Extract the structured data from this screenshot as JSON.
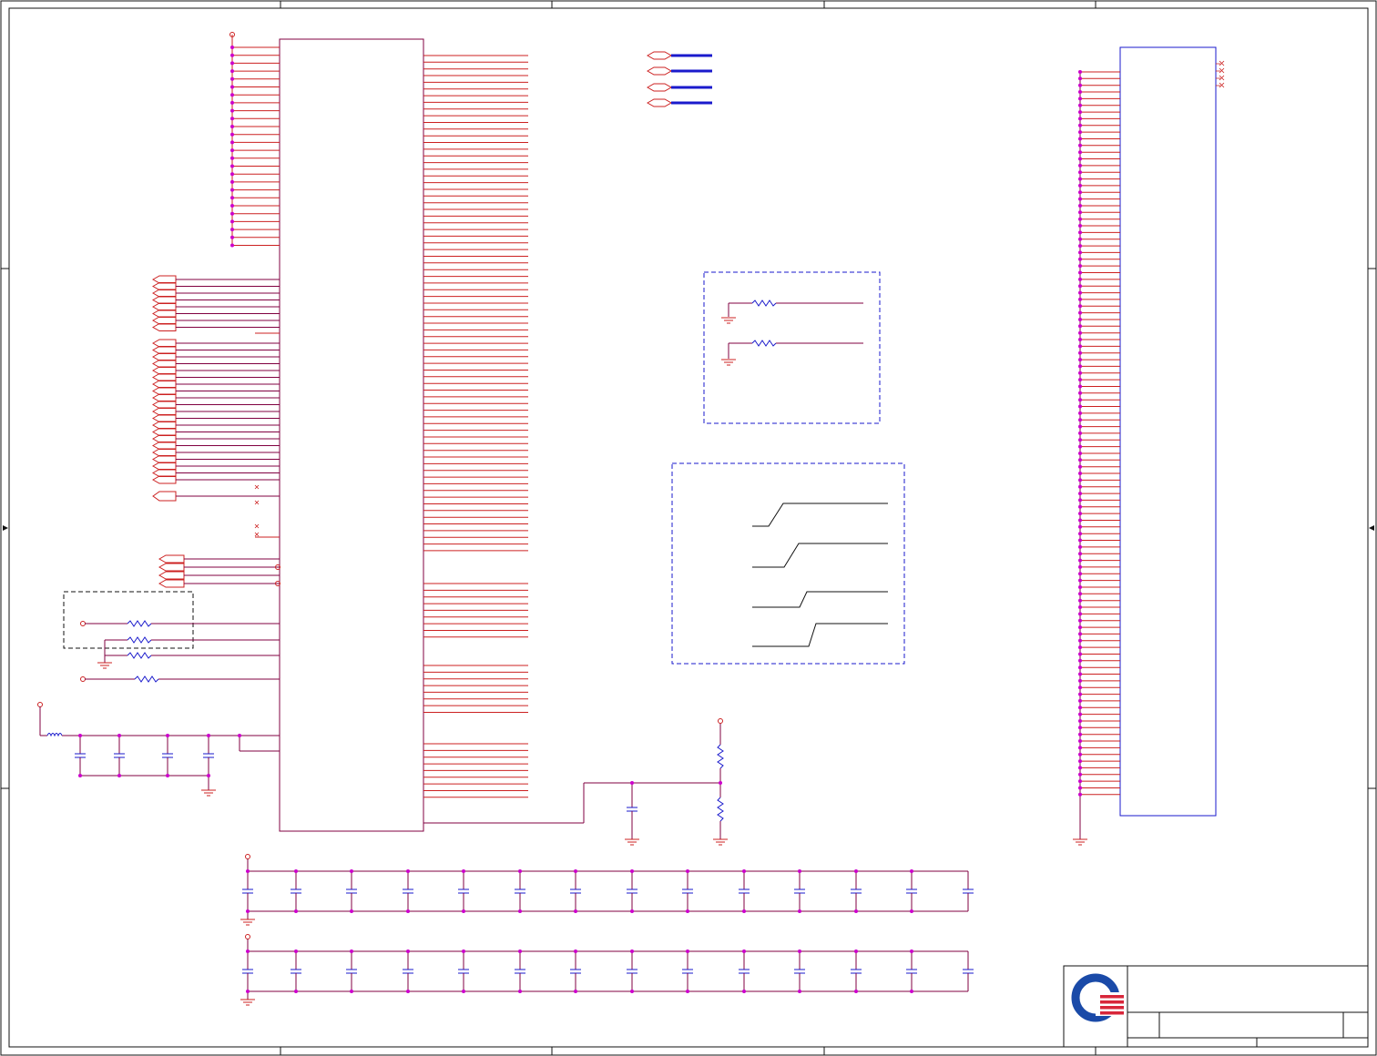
{
  "sheet": {
    "kind": "schematic-sheet",
    "title_block": {
      "logo": "company-logo",
      "title": "",
      "size": "",
      "doc_number": "",
      "rev": "",
      "date": "",
      "sheet": ""
    },
    "colors": {
      "wire": "#cc2020",
      "net": "#800040",
      "component": "#1a1acc",
      "border": "#111111",
      "power": "#cc2020",
      "junction": "#cc00cc",
      "ground": "#cc2020",
      "logo_blue": "#1a4aa8",
      "logo_red": "#d8263a"
    },
    "symbols": {
      "main_ic": "main-ic",
      "connector": "edge-connector",
      "capacitor_rows": 2,
      "capacitors_per_row": 14
    }
  }
}
